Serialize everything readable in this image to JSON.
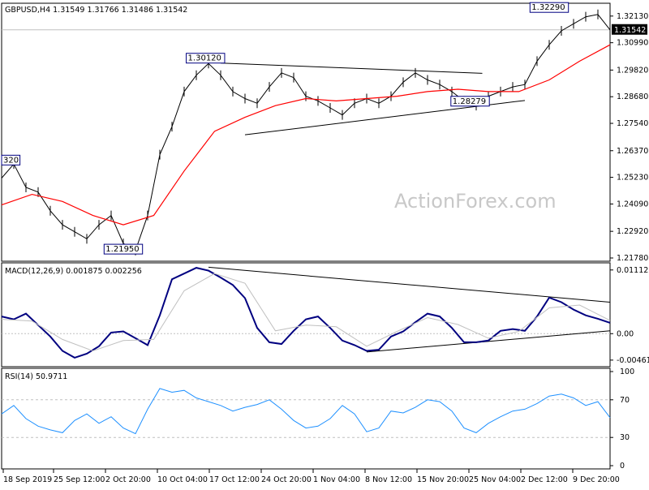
{
  "chart_data": [
    {
      "type": "candlestick",
      "panel": "price",
      "symbol_header": "GBPUSD,H4  1.31549 1.31766 1.31486 1.31542",
      "ylim": [
        1.2178,
        1.3254
      ],
      "y_ticks": [
        "1.32130",
        "1.30990",
        "1.29820",
        "1.28680",
        "1.27540",
        "1.26370",
        "1.25230",
        "1.24090",
        "1.22920",
        "1.21780"
      ],
      "y_tick_values": [
        1.3213,
        1.3099,
        1.2982,
        1.2868,
        1.2754,
        1.2637,
        1.2523,
        1.2409,
        1.2292,
        1.2178
      ],
      "current_price": "1.31542",
      "current_price_value": 1.31542,
      "watermark": "ActionForex.com",
      "annotations": [
        {
          "text": "1.32290",
          "x": 0.9,
          "y": 1.3229
        },
        {
          "text": "1.30120",
          "x": 0.335,
          "y": 1.3012
        },
        {
          "text": "1.28279",
          "x": 0.77,
          "y": 1.28279
        },
        {
          "text": "1.21950",
          "x": 0.2,
          "y": 1.2195
        },
        {
          "text": "320",
          "x": 0.0,
          "y": 1.2576
        }
      ],
      "trendlines": [
        {
          "x0": 0.36,
          "y0": 1.3012,
          "x1": 0.79,
          "y1": 1.2968
        },
        {
          "x0": 0.4,
          "y0": 1.2705,
          "x1": 0.86,
          "y1": 1.2852
        }
      ],
      "ma_color": "#ff0000",
      "price_color": "#000000",
      "series": [
        {
          "name": "price",
          "x": [
            0,
            0.02,
            0.04,
            0.06,
            0.08,
            0.1,
            0.12,
            0.14,
            0.16,
            0.18,
            0.2,
            0.22,
            0.24,
            0.26,
            0.28,
            0.3,
            0.32,
            0.34,
            0.36,
            0.38,
            0.4,
            0.42,
            0.44,
            0.46,
            0.48,
            0.5,
            0.52,
            0.54,
            0.56,
            0.58,
            0.6,
            0.62,
            0.64,
            0.66,
            0.68,
            0.7,
            0.72,
            0.74,
            0.76,
            0.78,
            0.8,
            0.82,
            0.84,
            0.86,
            0.88,
            0.9,
            0.92,
            0.94,
            0.96,
            0.98,
            1.0
          ],
          "y": [
            1.252,
            1.258,
            1.248,
            1.246,
            1.238,
            1.232,
            1.229,
            1.226,
            1.232,
            1.236,
            1.224,
            1.221,
            1.236,
            1.262,
            1.274,
            1.289,
            1.296,
            1.301,
            1.296,
            1.289,
            1.286,
            1.284,
            1.291,
            1.297,
            1.295,
            1.287,
            1.285,
            1.282,
            1.279,
            1.284,
            1.286,
            1.284,
            1.287,
            1.293,
            1.297,
            1.294,
            1.292,
            1.289,
            1.285,
            1.283,
            1.287,
            1.289,
            1.291,
            1.292,
            1.302,
            1.309,
            1.315,
            1.318,
            1.321,
            1.322,
            1.3154
          ]
        },
        {
          "name": "moving-average",
          "x": [
            0,
            0.05,
            0.1,
            0.15,
            0.2,
            0.25,
            0.3,
            0.35,
            0.4,
            0.45,
            0.5,
            0.55,
            0.6,
            0.65,
            0.7,
            0.75,
            0.8,
            0.85,
            0.9,
            0.95,
            1.0
          ],
          "y": [
            1.2405,
            1.245,
            1.242,
            1.236,
            1.232,
            1.236,
            1.255,
            1.272,
            1.278,
            1.283,
            1.286,
            1.285,
            1.286,
            1.287,
            1.289,
            1.29,
            1.289,
            1.289,
            1.294,
            1.302,
            1.309
          ]
        }
      ]
    },
    {
      "type": "line",
      "panel": "macd",
      "header": "MACD(12,26,9) 0.001875 0.002256",
      "ylim": [
        -0.0052,
        0.0118
      ],
      "y_ticks": [
        "0.011123",
        "0.00",
        "-0.004617"
      ],
      "y_tick_values": [
        0.011123,
        0.0,
        -0.004617
      ],
      "trendlines": [
        {
          "x0": 0.34,
          "y0": 0.0116,
          "x1": 1.0,
          "y1": 0.0055
        },
        {
          "x0": 0.6,
          "y0": -0.0032,
          "x1": 1.0,
          "y1": 0.0005
        }
      ],
      "series": [
        {
          "name": "macd",
          "color": "#000080",
          "x": [
            0,
            0.02,
            0.04,
            0.06,
            0.08,
            0.1,
            0.12,
            0.14,
            0.16,
            0.18,
            0.2,
            0.22,
            0.24,
            0.26,
            0.28,
            0.3,
            0.32,
            0.34,
            0.36,
            0.38,
            0.4,
            0.42,
            0.44,
            0.46,
            0.48,
            0.5,
            0.52,
            0.54,
            0.56,
            0.58,
            0.6,
            0.62,
            0.64,
            0.66,
            0.68,
            0.7,
            0.72,
            0.74,
            0.76,
            0.78,
            0.8,
            0.82,
            0.84,
            0.86,
            0.88,
            0.9,
            0.92,
            0.94,
            0.96,
            0.98,
            1.0
          ],
          "y": [
            0.003,
            0.0025,
            0.0035,
            0.0015,
            -0.0005,
            -0.003,
            -0.0042,
            -0.0035,
            -0.0022,
            0.0002,
            0.0004,
            -0.0008,
            -0.002,
            0.0032,
            0.0095,
            0.0105,
            0.0115,
            0.011,
            0.0098,
            0.0085,
            0.0062,
            0.001,
            -0.0015,
            -0.0018,
            0.0005,
            0.0025,
            0.003,
            0.001,
            -0.0012,
            -0.002,
            -0.003,
            -0.0028,
            -0.0005,
            0.0004,
            0.002,
            0.0035,
            0.003,
            0.001,
            -0.0015,
            -0.0015,
            -0.0012,
            0.0005,
            0.0008,
            0.0005,
            0.003,
            0.0063,
            0.0055,
            0.0042,
            0.0032,
            0.0026,
            0.0019
          ]
        },
        {
          "name": "signal",
          "color": "#c0c0c0",
          "x": [
            0,
            0.05,
            0.1,
            0.15,
            0.2,
            0.25,
            0.3,
            0.35,
            0.4,
            0.45,
            0.5,
            0.55,
            0.6,
            0.65,
            0.7,
            0.75,
            0.8,
            0.85,
            0.9,
            0.95,
            1.0
          ],
          "y": [
            0.0025,
            0.0022,
            -0.001,
            -0.003,
            -0.0012,
            -0.001,
            0.0075,
            0.0105,
            0.0088,
            0.0005,
            0.0015,
            0.0012,
            -0.0022,
            0.0004,
            0.0028,
            0.0016,
            -0.0008,
            0.0004,
            0.0045,
            0.005,
            0.0023
          ]
        }
      ]
    },
    {
      "type": "line",
      "panel": "rsi",
      "header": "RSI(14) 50.9711",
      "ylim": [
        0,
        100
      ],
      "y_ticks": [
        "100",
        "70",
        "30",
        "0"
      ],
      "y_tick_values": [
        100,
        70,
        30,
        0
      ],
      "levels": [
        70,
        30
      ],
      "series": [
        {
          "name": "rsi",
          "color": "#1e90ff",
          "x": [
            0,
            0.02,
            0.04,
            0.06,
            0.08,
            0.1,
            0.12,
            0.14,
            0.16,
            0.18,
            0.2,
            0.22,
            0.24,
            0.26,
            0.28,
            0.3,
            0.32,
            0.34,
            0.36,
            0.38,
            0.4,
            0.42,
            0.44,
            0.46,
            0.48,
            0.5,
            0.52,
            0.54,
            0.56,
            0.58,
            0.6,
            0.62,
            0.64,
            0.66,
            0.68,
            0.7,
            0.72,
            0.74,
            0.76,
            0.78,
            0.8,
            0.82,
            0.84,
            0.86,
            0.88,
            0.9,
            0.92,
            0.94,
            0.96,
            0.98,
            1.0
          ],
          "y": [
            55,
            64,
            50,
            42,
            38,
            35,
            48,
            55,
            45,
            52,
            40,
            34,
            60,
            82,
            78,
            80,
            72,
            68,
            64,
            58,
            62,
            65,
            70,
            60,
            48,
            40,
            42,
            50,
            64,
            55,
            36,
            40,
            58,
            56,
            62,
            70,
            68,
            58,
            40,
            35,
            45,
            52,
            58,
            60,
            66,
            74,
            76,
            72,
            64,
            68,
            51
          ]
        }
      ]
    }
  ],
  "x_ticks": [
    "18 Sep 2019",
    "25 Sep 12:00",
    "2 Oct 20:00",
    "10 Oct 04:00",
    "17 Oct 12:00",
    "24 Oct 20:00",
    "1 Nov 04:00",
    "8 Nov 12:00",
    "15 Nov 20:00",
    "25 Nov 04:00",
    "2 Dec 12:00",
    "9 Dec 20:00"
  ]
}
